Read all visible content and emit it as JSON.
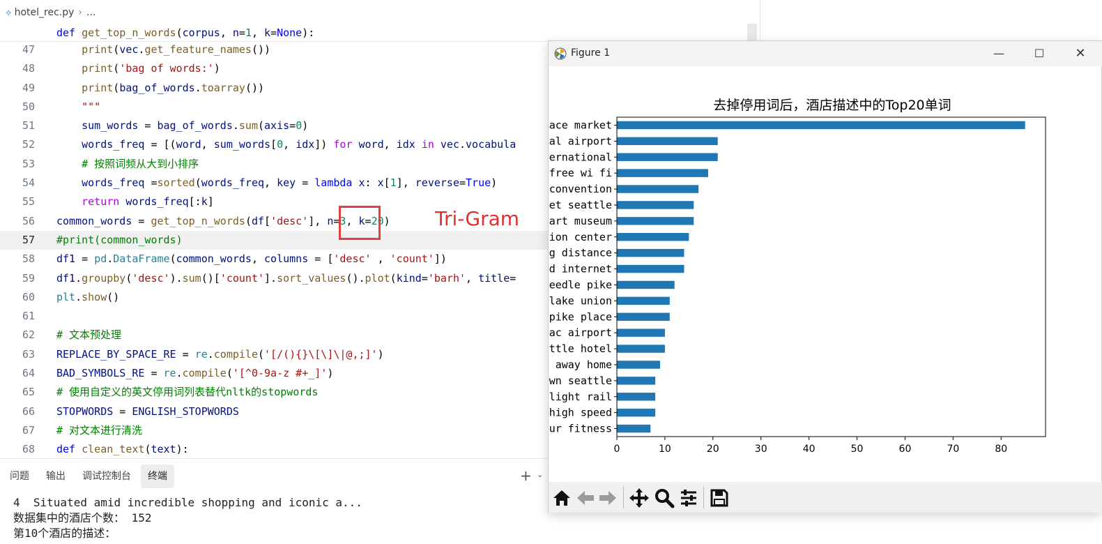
{
  "editor": {
    "breadcrumb": {
      "file": "hotel_rec.py",
      "more": "..."
    },
    "sticky_line": [
      {
        "t": "def ",
        "c": "t-kw"
      },
      {
        "t": "get_top_n_words",
        "c": "t-fn"
      },
      {
        "t": "(",
        "c": "t-plain"
      },
      {
        "t": "corpus",
        "c": "t-var"
      },
      {
        "t": ", ",
        "c": "t-plain"
      },
      {
        "t": "n",
        "c": "t-var"
      },
      {
        "t": "=",
        "c": "t-plain"
      },
      {
        "t": "1",
        "c": "t-num"
      },
      {
        "t": ", ",
        "c": "t-plain"
      },
      {
        "t": "k",
        "c": "t-var"
      },
      {
        "t": "=",
        "c": "t-plain"
      },
      {
        "t": "None",
        "c": "t-kw"
      },
      {
        "t": "):",
        "c": "t-plain"
      }
    ],
    "current_line": 57,
    "lines": [
      {
        "n": 47,
        "tokens": [
          {
            "t": "    ",
            "c": "t-plain"
          },
          {
            "t": "print",
            "c": "t-fn"
          },
          {
            "t": "(",
            "c": "t-plain"
          },
          {
            "t": "vec",
            "c": "t-var"
          },
          {
            "t": ".",
            "c": "t-plain"
          },
          {
            "t": "get_feature_names",
            "c": "t-fn"
          },
          {
            "t": "())",
            "c": "t-plain"
          }
        ]
      },
      {
        "n": 48,
        "tokens": [
          {
            "t": "    ",
            "c": "t-plain"
          },
          {
            "t": "print",
            "c": "t-fn"
          },
          {
            "t": "(",
            "c": "t-plain"
          },
          {
            "t": "'bag of words:'",
            "c": "t-str"
          },
          {
            "t": ")",
            "c": "t-plain"
          }
        ]
      },
      {
        "n": 49,
        "tokens": [
          {
            "t": "    ",
            "c": "t-plain"
          },
          {
            "t": "print",
            "c": "t-fn"
          },
          {
            "t": "(",
            "c": "t-plain"
          },
          {
            "t": "bag_of_words",
            "c": "t-var"
          },
          {
            "t": ".",
            "c": "t-plain"
          },
          {
            "t": "toarray",
            "c": "t-fn"
          },
          {
            "t": "())",
            "c": "t-plain"
          }
        ]
      },
      {
        "n": 50,
        "tokens": [
          {
            "t": "    ",
            "c": "t-plain"
          },
          {
            "t": "\"\"\"",
            "c": "t-str"
          }
        ]
      },
      {
        "n": 51,
        "tokens": [
          {
            "t": "    ",
            "c": "t-plain"
          },
          {
            "t": "sum_words",
            "c": "t-var"
          },
          {
            "t": " = ",
            "c": "t-plain"
          },
          {
            "t": "bag_of_words",
            "c": "t-var"
          },
          {
            "t": ".",
            "c": "t-plain"
          },
          {
            "t": "sum",
            "c": "t-fn"
          },
          {
            "t": "(",
            "c": "t-plain"
          },
          {
            "t": "axis",
            "c": "t-var"
          },
          {
            "t": "=",
            "c": "t-plain"
          },
          {
            "t": "0",
            "c": "t-num"
          },
          {
            "t": ")",
            "c": "t-plain"
          }
        ]
      },
      {
        "n": 52,
        "tokens": [
          {
            "t": "    ",
            "c": "t-plain"
          },
          {
            "t": "words_freq",
            "c": "t-var"
          },
          {
            "t": " = [(",
            "c": "t-plain"
          },
          {
            "t": "word",
            "c": "t-var"
          },
          {
            "t": ", ",
            "c": "t-plain"
          },
          {
            "t": "sum_words",
            "c": "t-var"
          },
          {
            "t": "[",
            "c": "t-plain"
          },
          {
            "t": "0",
            "c": "t-num"
          },
          {
            "t": ", ",
            "c": "t-plain"
          },
          {
            "t": "idx",
            "c": "t-var"
          },
          {
            "t": "]) ",
            "c": "t-plain"
          },
          {
            "t": "for",
            "c": "t-ctl"
          },
          {
            "t": " ",
            "c": "t-plain"
          },
          {
            "t": "word",
            "c": "t-var"
          },
          {
            "t": ", ",
            "c": "t-plain"
          },
          {
            "t": "idx",
            "c": "t-var"
          },
          {
            "t": " ",
            "c": "t-plain"
          },
          {
            "t": "in",
            "c": "t-ctl"
          },
          {
            "t": " ",
            "c": "t-plain"
          },
          {
            "t": "vec",
            "c": "t-var"
          },
          {
            "t": ".",
            "c": "t-plain"
          },
          {
            "t": "vocabula",
            "c": "t-var"
          }
        ]
      },
      {
        "n": 53,
        "tokens": [
          {
            "t": "    ",
            "c": "t-plain"
          },
          {
            "t": "# 按照词频从大到小排序",
            "c": "t-com"
          }
        ]
      },
      {
        "n": 54,
        "tokens": [
          {
            "t": "    ",
            "c": "t-plain"
          },
          {
            "t": "words_freq",
            "c": "t-var"
          },
          {
            "t": " =",
            "c": "t-plain"
          },
          {
            "t": "sorted",
            "c": "t-fn"
          },
          {
            "t": "(",
            "c": "t-plain"
          },
          {
            "t": "words_freq",
            "c": "t-var"
          },
          {
            "t": ", ",
            "c": "t-plain"
          },
          {
            "t": "key",
            "c": "t-var"
          },
          {
            "t": " = ",
            "c": "t-plain"
          },
          {
            "t": "lambda",
            "c": "t-kw"
          },
          {
            "t": " ",
            "c": "t-plain"
          },
          {
            "t": "x",
            "c": "t-var"
          },
          {
            "t": ": ",
            "c": "t-plain"
          },
          {
            "t": "x",
            "c": "t-var"
          },
          {
            "t": "[",
            "c": "t-plain"
          },
          {
            "t": "1",
            "c": "t-num"
          },
          {
            "t": "], ",
            "c": "t-plain"
          },
          {
            "t": "reverse",
            "c": "t-var"
          },
          {
            "t": "=",
            "c": "t-plain"
          },
          {
            "t": "True",
            "c": "t-kw"
          },
          {
            "t": ")",
            "c": "t-plain"
          }
        ]
      },
      {
        "n": 55,
        "tokens": [
          {
            "t": "    ",
            "c": "t-plain"
          },
          {
            "t": "return",
            "c": "t-ctl"
          },
          {
            "t": " ",
            "c": "t-plain"
          },
          {
            "t": "words_freq",
            "c": "t-var"
          },
          {
            "t": "[:",
            "c": "t-plain"
          },
          {
            "t": "k",
            "c": "t-var"
          },
          {
            "t": "]",
            "c": "t-plain"
          }
        ]
      },
      {
        "n": 56,
        "tokens": [
          {
            "t": "common_words",
            "c": "t-var"
          },
          {
            "t": " = ",
            "c": "t-plain"
          },
          {
            "t": "get_top_n_words",
            "c": "t-fn"
          },
          {
            "t": "(",
            "c": "t-plain"
          },
          {
            "t": "df",
            "c": "t-var"
          },
          {
            "t": "[",
            "c": "t-plain"
          },
          {
            "t": "'desc'",
            "c": "t-str"
          },
          {
            "t": "], ",
            "c": "t-plain"
          },
          {
            "t": "n",
            "c": "t-var"
          },
          {
            "t": "=",
            "c": "t-plain"
          },
          {
            "t": "3",
            "c": "t-num"
          },
          {
            "t": ", ",
            "c": "t-plain"
          },
          {
            "t": "k",
            "c": "t-var"
          },
          {
            "t": "=",
            "c": "t-plain"
          },
          {
            "t": "20",
            "c": "t-num"
          },
          {
            "t": ")",
            "c": "t-plain"
          }
        ]
      },
      {
        "n": 57,
        "tokens": [
          {
            "t": "#print(common_words)",
            "c": "t-com"
          }
        ]
      },
      {
        "n": 58,
        "tokens": [
          {
            "t": "df1",
            "c": "t-var"
          },
          {
            "t": " = ",
            "c": "t-plain"
          },
          {
            "t": "pd",
            "c": "t-mod"
          },
          {
            "t": ".",
            "c": "t-plain"
          },
          {
            "t": "DataFrame",
            "c": "t-cls"
          },
          {
            "t": "(",
            "c": "t-plain"
          },
          {
            "t": "common_words",
            "c": "t-var"
          },
          {
            "t": ", ",
            "c": "t-plain"
          },
          {
            "t": "columns",
            "c": "t-var"
          },
          {
            "t": " = [",
            "c": "t-plain"
          },
          {
            "t": "'desc'",
            "c": "t-str"
          },
          {
            "t": " , ",
            "c": "t-plain"
          },
          {
            "t": "'count'",
            "c": "t-str"
          },
          {
            "t": "])",
            "c": "t-plain"
          }
        ]
      },
      {
        "n": 59,
        "tokens": [
          {
            "t": "df1",
            "c": "t-var"
          },
          {
            "t": ".",
            "c": "t-plain"
          },
          {
            "t": "groupby",
            "c": "t-fn"
          },
          {
            "t": "(",
            "c": "t-plain"
          },
          {
            "t": "'desc'",
            "c": "t-str"
          },
          {
            "t": ").",
            "c": "t-plain"
          },
          {
            "t": "sum",
            "c": "t-fn"
          },
          {
            "t": "()[",
            "c": "t-plain"
          },
          {
            "t": "'count'",
            "c": "t-str"
          },
          {
            "t": "].",
            "c": "t-plain"
          },
          {
            "t": "sort_values",
            "c": "t-fn"
          },
          {
            "t": "().",
            "c": "t-plain"
          },
          {
            "t": "plot",
            "c": "t-fn"
          },
          {
            "t": "(",
            "c": "t-plain"
          },
          {
            "t": "kind",
            "c": "t-var"
          },
          {
            "t": "=",
            "c": "t-plain"
          },
          {
            "t": "'barh'",
            "c": "t-str"
          },
          {
            "t": ", ",
            "c": "t-plain"
          },
          {
            "t": "title",
            "c": "t-var"
          },
          {
            "t": "=",
            "c": "t-plain"
          }
        ]
      },
      {
        "n": 60,
        "tokens": [
          {
            "t": "plt",
            "c": "t-mod"
          },
          {
            "t": ".",
            "c": "t-plain"
          },
          {
            "t": "show",
            "c": "t-fn"
          },
          {
            "t": "()",
            "c": "t-plain"
          }
        ]
      },
      {
        "n": 61,
        "tokens": []
      },
      {
        "n": 62,
        "tokens": [
          {
            "t": "# 文本预处理",
            "c": "t-com"
          }
        ]
      },
      {
        "n": 63,
        "tokens": [
          {
            "t": "REPLACE_BY_SPACE_RE",
            "c": "t-var"
          },
          {
            "t": " = ",
            "c": "t-plain"
          },
          {
            "t": "re",
            "c": "t-mod"
          },
          {
            "t": ".",
            "c": "t-plain"
          },
          {
            "t": "compile",
            "c": "t-fn"
          },
          {
            "t": "(",
            "c": "t-plain"
          },
          {
            "t": "'[/(){}\\[\\]\\|@,;]'",
            "c": "t-str"
          },
          {
            "t": ")",
            "c": "t-plain"
          }
        ]
      },
      {
        "n": 64,
        "tokens": [
          {
            "t": "BAD_SYMBOLS_RE",
            "c": "t-var"
          },
          {
            "t": " = ",
            "c": "t-plain"
          },
          {
            "t": "re",
            "c": "t-mod"
          },
          {
            "t": ".",
            "c": "t-plain"
          },
          {
            "t": "compile",
            "c": "t-fn"
          },
          {
            "t": "(",
            "c": "t-plain"
          },
          {
            "t": "'[^0-9a-z #+_]'",
            "c": "t-str"
          },
          {
            "t": ")",
            "c": "t-plain"
          }
        ]
      },
      {
        "n": 65,
        "tokens": [
          {
            "t": "# 使用自定义的英文停用词列表替代nltk的stopwords",
            "c": "t-com"
          }
        ]
      },
      {
        "n": 66,
        "tokens": [
          {
            "t": "STOPWORDS",
            "c": "t-var"
          },
          {
            "t": " = ",
            "c": "t-plain"
          },
          {
            "t": "ENGLISH_STOPWORDS",
            "c": "t-var"
          }
        ]
      },
      {
        "n": 67,
        "tokens": [
          {
            "t": "# 对文本进行清洗",
            "c": "t-com"
          }
        ]
      },
      {
        "n": 68,
        "tokens": [
          {
            "t": "def ",
            "c": "t-kw"
          },
          {
            "t": "clean_text",
            "c": "t-fn"
          },
          {
            "t": "(",
            "c": "t-plain"
          },
          {
            "t": "text",
            "c": "t-var"
          },
          {
            "t": "):",
            "c": "t-plain"
          }
        ]
      }
    ]
  },
  "annotation": {
    "label": "Tri-Gram",
    "color": "#e03030"
  },
  "panel": {
    "tabs": [
      "问题",
      "输出",
      "调试控制台",
      "终端"
    ],
    "active_tab": 3,
    "add_label": "+",
    "terminal_lines": [
      "4  Situated amid incredible shopping and iconic a...",
      "数据集中的酒店个数： 152",
      "第10个酒店的描述："
    ]
  },
  "figure": {
    "window_title": "Figure 1",
    "controls": {
      "minimize": "—",
      "maximize": "☐",
      "close": "✕"
    },
    "toolbar": [
      "home-icon",
      "back-icon",
      "forward-icon",
      "pan-icon",
      "zoom-icon",
      "configure-icon",
      "save-icon"
    ]
  },
  "chart_data": {
    "type": "bar",
    "orientation": "horizontal",
    "title": "去掉停用词后，酒店描述中的Top20单词",
    "bar_color": "#1f77b4",
    "categories": [
      "ace market",
      "al airport",
      "ernational",
      "free wi fi",
      "convention",
      "et seattle",
      "art museum",
      "ion center",
      "g distance",
      "d internet",
      "eedle pike",
      "lake union",
      "pike place",
      "ac airport",
      "ttle hotel",
      " away home",
      "wn seattle",
      "light rail",
      "high speed",
      "ur fitness"
    ],
    "values": [
      85,
      21,
      21,
      19,
      17,
      16,
      16,
      15,
      14,
      14,
      12,
      11,
      11,
      10,
      10,
      9,
      8,
      8,
      8,
      7
    ],
    "xlim": [
      0,
      89.25
    ],
    "xticks": [
      0,
      10,
      20,
      30,
      40,
      50,
      60,
      70,
      80
    ],
    "xlabel": "",
    "ylabel": "",
    "grid": false
  }
}
